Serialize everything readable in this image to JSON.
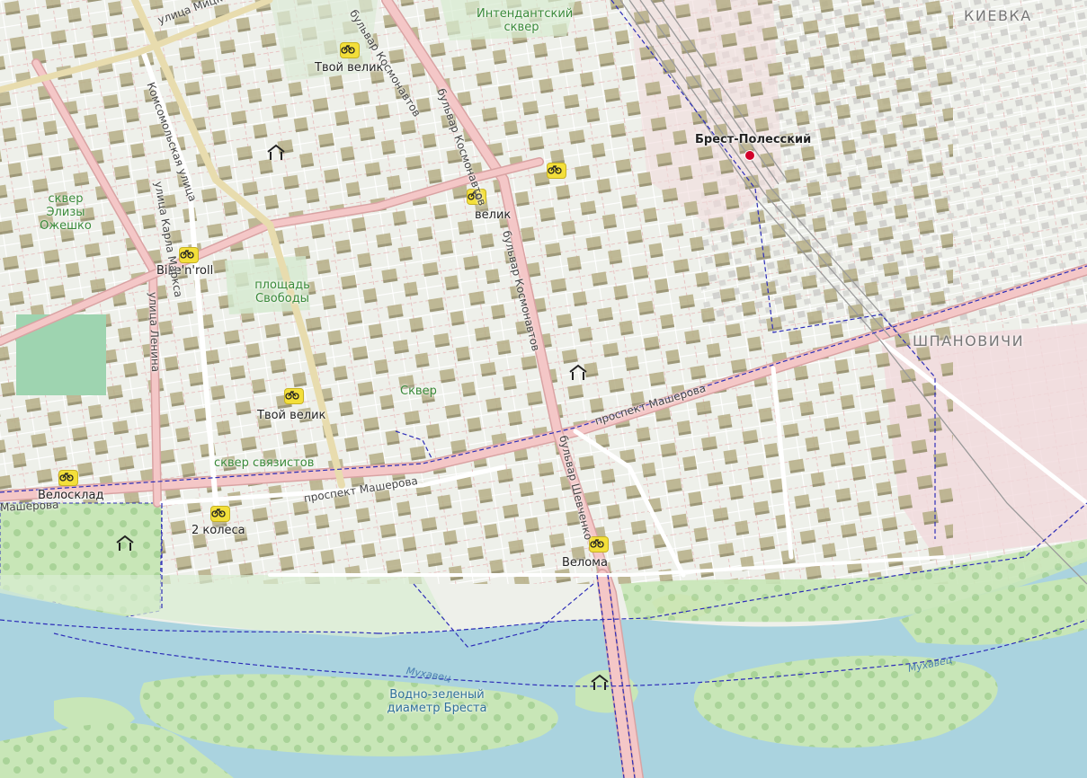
{
  "map": {
    "colors": {
      "background": "#eef0ea",
      "water": "#aad3df",
      "park": "#c8e6b7",
      "building": "#b5ae86",
      "main_road": "#f4c7c7",
      "street": "#ffffff",
      "route": "#2d2db8",
      "rail": "#9a9a9a",
      "bicycle_badge": "#f3df3a",
      "station": "#d2002b"
    },
    "places": [
      {
        "id": "kievka",
        "text": "КИЕВКА"
      },
      {
        "id": "shpanovichi",
        "text": "ШПАНОВИЧИ"
      }
    ],
    "bike_shops": [
      {
        "id": "tvoi-velik-north",
        "text": "Твой велик"
      },
      {
        "id": "evelik",
        "text": "велик"
      },
      {
        "id": "bike-n-roll",
        "text": "Bike'n'roll"
      },
      {
        "id": "tvoi-velik-south",
        "text": "Твой велик"
      },
      {
        "id": "velosklad",
        "text": "Велосклад"
      },
      {
        "id": "dva-kolesa",
        "text": "2 колеса"
      },
      {
        "id": "veloma",
        "text": "Велома"
      }
    ],
    "parks": [
      {
        "id": "intendantsky",
        "text": "Интендантский сквер"
      },
      {
        "id": "elizy",
        "text": "сквер Элизы Ожешко"
      },
      {
        "id": "svobody",
        "text": "площадь Свободы"
      },
      {
        "id": "skver",
        "text": "Сквер"
      },
      {
        "id": "svyazistov",
        "text": "сквер связистов"
      },
      {
        "id": "vodno",
        "text": "Водно-зеленый диаметр Бреста"
      }
    ],
    "streets": [
      {
        "id": "mitskevicha",
        "text": "улица Мицкевича"
      },
      {
        "id": "komsomolskaya",
        "text": "Комсомольская улица"
      },
      {
        "id": "karla",
        "text": "улица Карла Маркса"
      },
      {
        "id": "lenina",
        "text": "улица Ленина"
      },
      {
        "id": "kosmonavtov-1",
        "text": "бульвар Космонавтов"
      },
      {
        "id": "kosmonavtov-2",
        "text": "бульвар Космонавтов"
      },
      {
        "id": "kosmonavtov-3",
        "text": "бульвар Космонавтов"
      },
      {
        "id": "masherova-east",
        "text": "проспект Машерова"
      },
      {
        "id": "masherova-mid",
        "text": "проспект Машерова"
      },
      {
        "id": "masherova-west",
        "text": "Машерова"
      },
      {
        "id": "shevchenko",
        "text": "бульвар Шевченко"
      }
    ],
    "water_labels": [
      {
        "id": "mukhavets-west",
        "text": "Мухавец"
      },
      {
        "id": "mukhavets-east",
        "text": "Мухавец"
      }
    ],
    "station": {
      "text": "Брест-Полесский"
    }
  }
}
